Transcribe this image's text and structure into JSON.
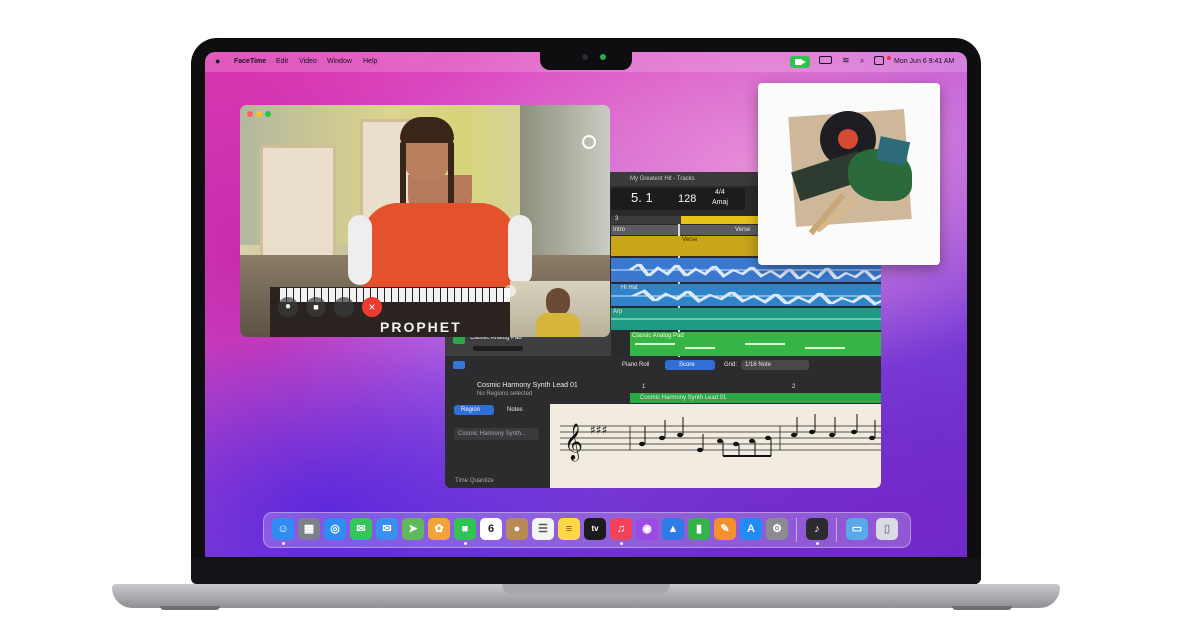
{
  "menubar": {
    "app_name": "FaceTime",
    "menus": [
      "Edit",
      "Video",
      "Window",
      "Help"
    ],
    "datetime": "Mon Jun 6  9:41 AM"
  },
  "facetime": {
    "device_brand": "PROPHET"
  },
  "logic": {
    "title": "My Greatest Hit - Tracks",
    "lcd": {
      "position": "5. 1",
      "tempo": "128",
      "signature": "4/4",
      "key": "Amaj",
      "bar": "3"
    },
    "sections": [
      "Intro",
      "Verse"
    ],
    "region_labels": [
      "Verse",
      "Hi Hat",
      "Arp",
      "Classic Analog Pad"
    ],
    "tracks": [
      {
        "name": "Classic Analog Pad"
      }
    ],
    "editor": {
      "tabs": [
        "Piano Roll",
        "Score"
      ],
      "grid_label": "Grid:",
      "grid_value": "1/16 Note",
      "region_name": "Cosmic Harmony Synth Lead 01",
      "region_status": "No Regions selected",
      "inspector_tabs": [
        "Region",
        "Notes"
      ],
      "inspector_field": "Cosmic Harmony Synth...",
      "time_quantize": "Time Quantize",
      "ruler": [
        "1",
        "2"
      ],
      "score_region": "Cosmic Harmony Synth Lead 01"
    }
  },
  "dock": {
    "apps": [
      {
        "name": "Finder",
        "icon": "finder-icon",
        "color": "#2f8cf5",
        "glyph": "☺"
      },
      {
        "name": "Launchpad",
        "icon": "launchpad-icon",
        "color": "#7d7f8a",
        "glyph": "▦"
      },
      {
        "name": "Safari",
        "icon": "safari-icon",
        "color": "#2d8df2",
        "glyph": "◎"
      },
      {
        "name": "Messages",
        "icon": "messages-icon",
        "color": "#33c759",
        "glyph": "✉"
      },
      {
        "name": "Mail",
        "icon": "mail-icon",
        "color": "#3a8ff2",
        "glyph": "✉"
      },
      {
        "name": "Maps",
        "icon": "maps-icon",
        "color": "#5fb85a",
        "glyph": "➤"
      },
      {
        "name": "Photos",
        "icon": "photos-icon",
        "color": "#f2a33a",
        "glyph": "✿"
      },
      {
        "name": "FaceTime",
        "icon": "facetime-icon",
        "color": "#30c452",
        "glyph": "■"
      },
      {
        "name": "Calendar",
        "icon": "calendar-icon",
        "color": "#ffffff",
        "glyph": "6"
      },
      {
        "name": "Contacts",
        "icon": "contacts-icon",
        "color": "#b98a55",
        "glyph": "●"
      },
      {
        "name": "Reminders",
        "icon": "reminders-icon",
        "color": "#f4f4f4",
        "glyph": "☰"
      },
      {
        "name": "Notes",
        "icon": "notes-icon",
        "color": "#ffd84a",
        "glyph": "≡"
      },
      {
        "name": "TV",
        "icon": "tv-icon",
        "color": "#1b1b1e",
        "glyph": "tv"
      },
      {
        "name": "Music",
        "icon": "music-icon",
        "color": "#f2425a",
        "glyph": "♫"
      },
      {
        "name": "Podcasts",
        "icon": "podcasts-icon",
        "color": "#9b4ae6",
        "glyph": "◉"
      },
      {
        "name": "Keynote",
        "icon": "keynote-icon",
        "color": "#2f7be6",
        "glyph": "▲"
      },
      {
        "name": "Numbers",
        "icon": "numbers-icon",
        "color": "#33b34a",
        "glyph": "▮"
      },
      {
        "name": "Pages",
        "icon": "pages-icon",
        "color": "#f5902e",
        "glyph": "✎"
      },
      {
        "name": "App Store",
        "icon": "app-store-icon",
        "color": "#1f8df5",
        "glyph": "A"
      },
      {
        "name": "System Preferences",
        "icon": "system-preferences-icon",
        "color": "#8b8c93",
        "glyph": "⚙"
      },
      {
        "name": "Logic Pro",
        "icon": "logic-pro-icon",
        "color": "#2b2b30",
        "glyph": "♪"
      },
      {
        "name": "Downloads",
        "icon": "downloads-folder-icon",
        "color": "#59a8e8",
        "glyph": "▭"
      },
      {
        "name": "Trash",
        "icon": "trash-icon",
        "color": "#d9dde3",
        "glyph": "▯"
      }
    ]
  }
}
